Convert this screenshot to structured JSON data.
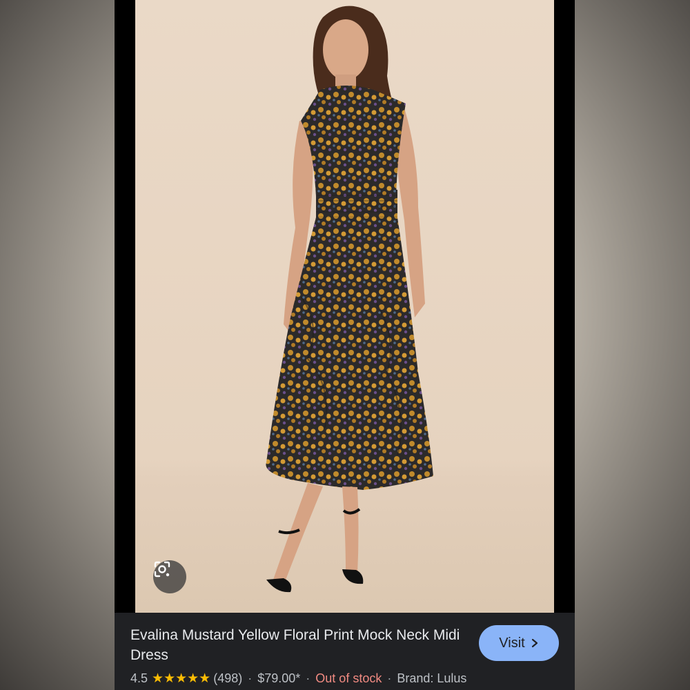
{
  "product": {
    "title": "Evalina Mustard Yellow Floral Print Mock Neck Midi Dress",
    "visit_label": "Visit",
    "visit_icon": "chevron-right-icon",
    "rating": "4.5",
    "stars": "★★★★★",
    "review_count": "(498)",
    "price": "$79.00*",
    "availability": "Out of stock",
    "brand": "Brand: Lulus",
    "separator": "·"
  },
  "lens_icon": "lens-search-icon",
  "colors": {
    "accent": "#8ab4f8",
    "card_bg": "#202124",
    "star": "#fbbc04",
    "out_of_stock": "#f28b82",
    "dress_mustard": "#b8862e",
    "backdrop": "#e6d3bf"
  }
}
